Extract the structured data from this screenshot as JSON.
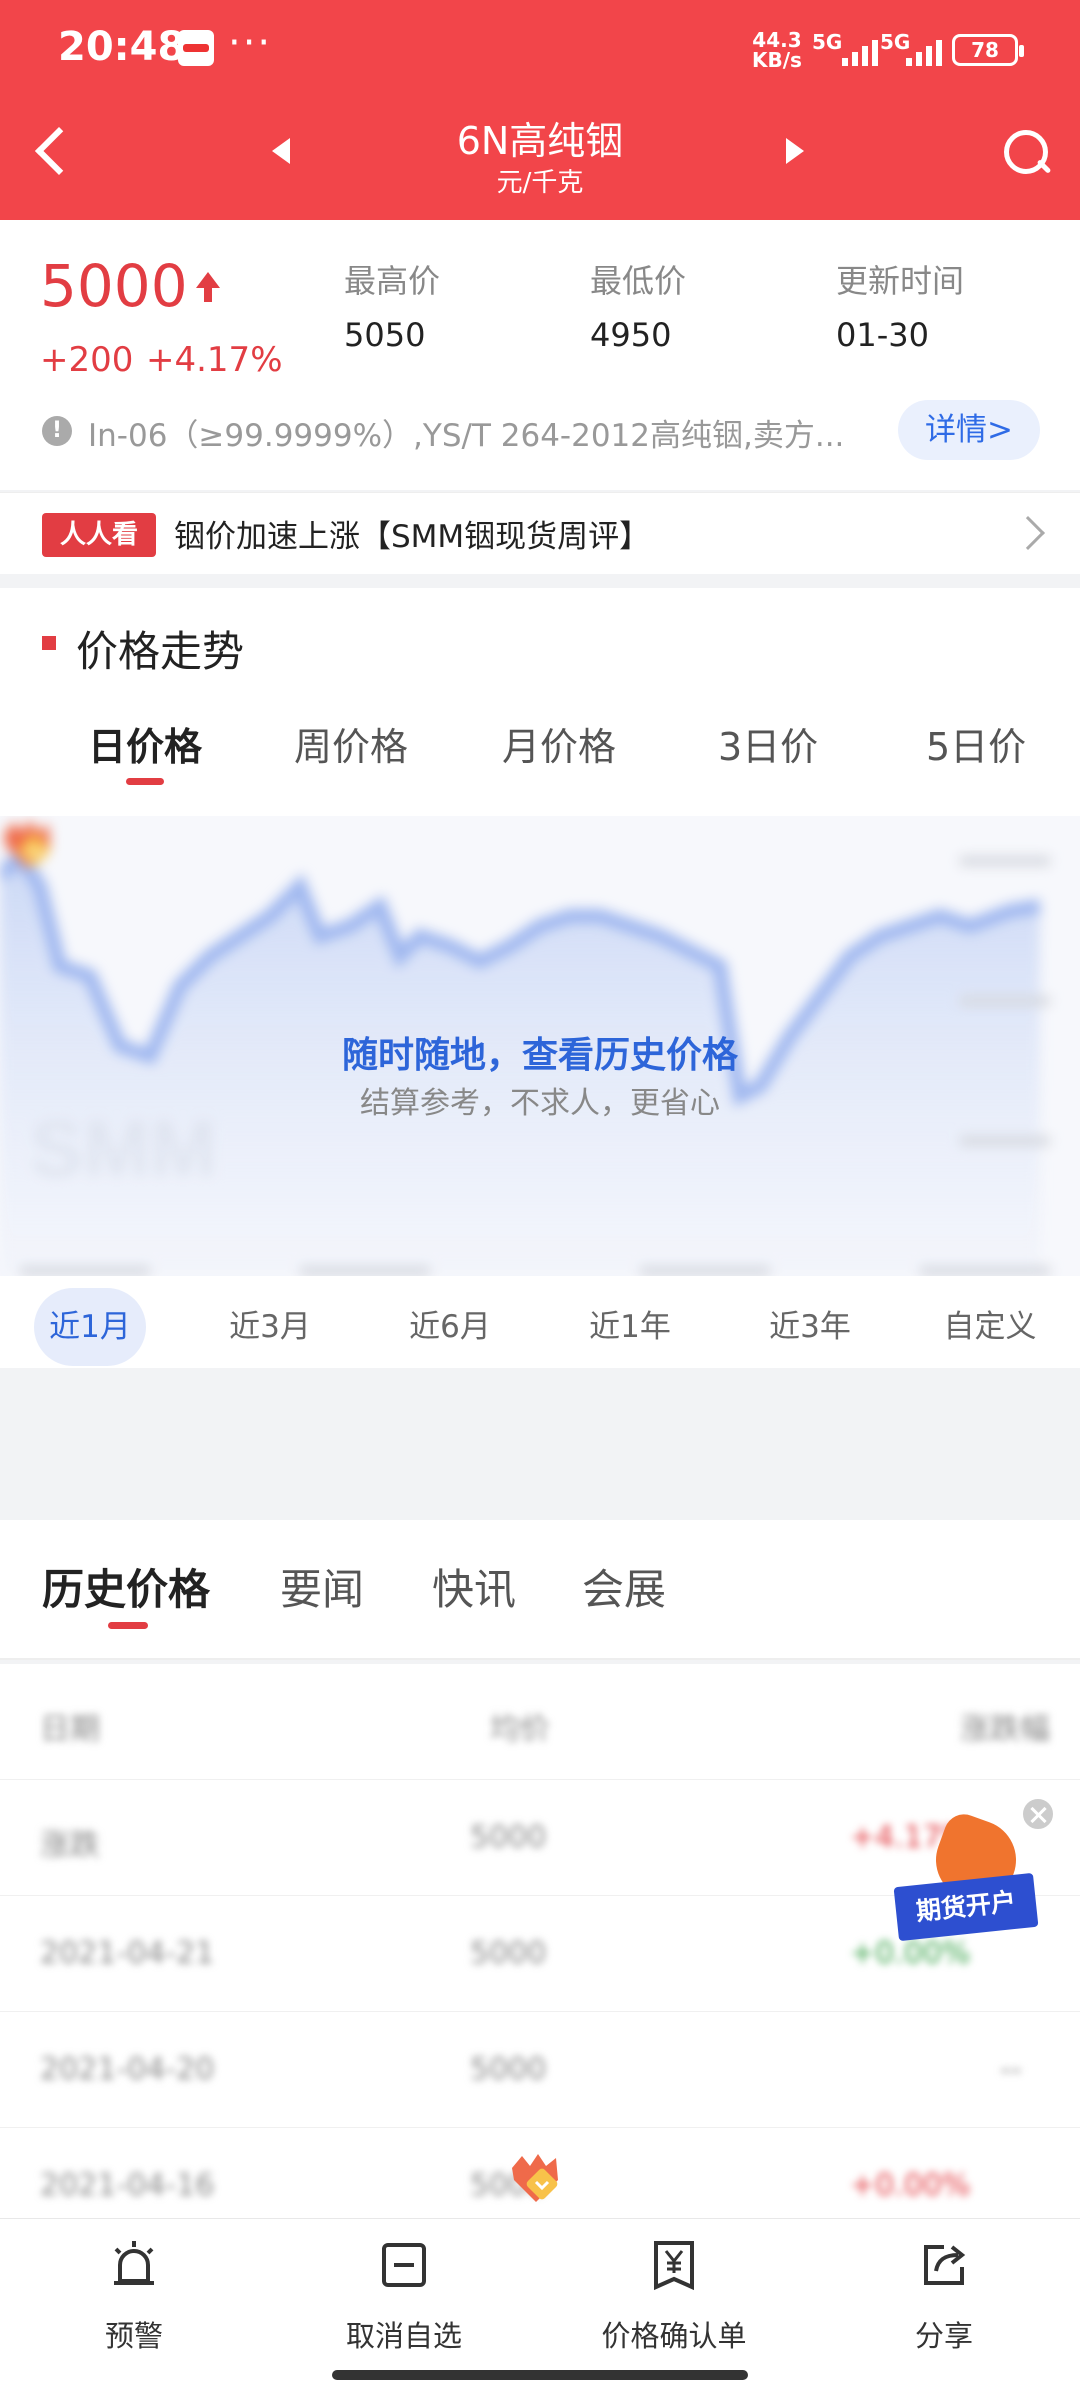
{
  "status_bar": {
    "time": "20:48",
    "network_speed_value": "44.3",
    "network_speed_unit": "KB/s",
    "signal1": "5G",
    "signal2": "5G",
    "battery": "78"
  },
  "header": {
    "title": "6N高纯铟",
    "unit": "元/千克"
  },
  "summary": {
    "price": "5000",
    "change": "+200",
    "change_pct": "+4.17%",
    "high_label": "最高价",
    "high_value": "5050",
    "low_label": "最低价",
    "low_value": "4950",
    "update_label": "更新时间",
    "update_value": "01-30",
    "description": "In-06（≥99.9999%）,YS/T 264-2012高纯铟,卖方...",
    "detail_button": "详情>"
  },
  "news": {
    "badge": "人人看",
    "headline": "铟价加速上涨【SMM铟现货周评】"
  },
  "trend": {
    "section_title": "价格走势",
    "period_tabs": [
      "日价格",
      "周价格",
      "月价格",
      "3日价",
      "5日价"
    ],
    "active_period": 0,
    "overlay_title": "随时随地，查看历史价格",
    "overlay_subtitle": "结算参考，不求人，更省心",
    "ranges": [
      "近1月",
      "近3月",
      "近6月",
      "近1年",
      "近3年",
      "自定义"
    ],
    "active_range": 0
  },
  "content_tabs": {
    "items": [
      "历史价格",
      "要闻",
      "快讯",
      "会展"
    ],
    "active": 0
  },
  "history": {
    "rows": [
      [
        "日期",
        "均价",
        "涨跌幅"
      ],
      [
        "涨跌",
        "5000",
        "+4.17%"
      ],
      [
        "2021-04-21",
        "5000",
        "+0.00%"
      ],
      [
        "2021-04-20",
        "5000",
        "--"
      ],
      [
        "2021-04-16",
        "5000",
        "+0.00%"
      ]
    ]
  },
  "float_ad": {
    "label": "期货开户"
  },
  "toolbar": {
    "items": [
      {
        "label": "预警",
        "icon": "alarm-icon"
      },
      {
        "label": "取消自选",
        "icon": "remove-favorite-icon"
      },
      {
        "label": "价格确认单",
        "icon": "yuan-receipt-icon"
      },
      {
        "label": "分享",
        "icon": "share-icon"
      }
    ]
  },
  "colors": {
    "brand_red": "#f2454a",
    "price_red": "#e23d43",
    "accent_blue": "#2d65d9"
  }
}
